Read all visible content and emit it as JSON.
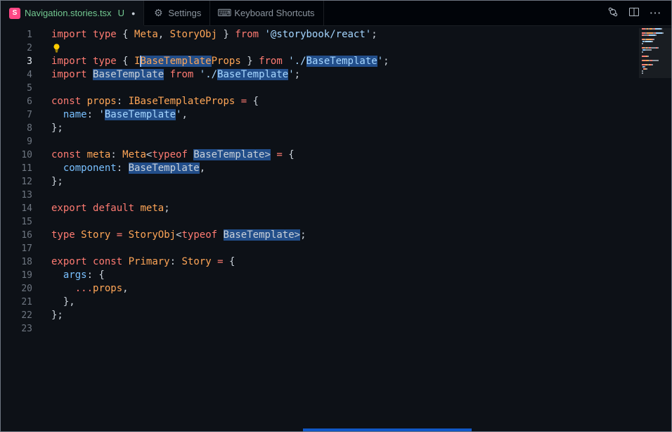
{
  "colors": {
    "editor_bg": "#0d1117",
    "tabbar_bg": "#010409",
    "accent_selection": "rgba(56,139,253,0.5)",
    "keyword": "#ff7b72",
    "type": "#ffa657",
    "property": "#79c0ff",
    "string": "#a5d6ff",
    "foreground": "#c9d1d9",
    "untracked_green": "#73c991",
    "storybook_pink": "#ff4785",
    "progress_blue": "#1158c7"
  },
  "tab_bar": {
    "modified_dot": "●",
    "tabs": [
      {
        "id": "navigation-stories",
        "label": "Navigation.stories.tsx",
        "icon": "storybook",
        "glyph": "S",
        "badge": "U",
        "modified": true,
        "active": true
      },
      {
        "id": "settings",
        "label": "Settings",
        "icon": "gear",
        "glyph": "⚙",
        "active": false
      },
      {
        "id": "keyboard-shortcuts",
        "label": "Keyboard Shortcuts",
        "icon": "keyboard",
        "glyph": "⌨",
        "active": false
      }
    ],
    "actions": [
      {
        "id": "open-changes"
      },
      {
        "id": "split-editor"
      },
      {
        "id": "more-actions",
        "glyph": "⋯"
      }
    ]
  },
  "editor": {
    "active_line": 3,
    "total_lines": 23,
    "lines": [
      {
        "n": 1,
        "t": [
          [
            "import",
            "kw"
          ],
          [
            " ",
            "fg"
          ],
          [
            "type",
            "kw"
          ],
          [
            " { ",
            "fg"
          ],
          [
            "Meta",
            "typ"
          ],
          [
            ", ",
            "fg"
          ],
          [
            "StoryObj",
            "typ"
          ],
          [
            " } ",
            "fg"
          ],
          [
            "from",
            "kw"
          ],
          [
            " ",
            "fg"
          ],
          [
            "'@storybook/react'",
            "str"
          ],
          [
            ";",
            "fg"
          ]
        ]
      },
      {
        "n": 2,
        "lightbulb": true,
        "t": []
      },
      {
        "n": 3,
        "t": [
          [
            "import",
            "kw"
          ],
          [
            " ",
            "fg"
          ],
          [
            "type",
            "kw"
          ],
          [
            " { ",
            "fg"
          ],
          [
            "I",
            "typ"
          ],
          [
            "",
            "cursor"
          ],
          [
            "BaseTemplate",
            "typ",
            1
          ],
          [
            "Props",
            "typ"
          ],
          [
            " } ",
            "fg"
          ],
          [
            "from",
            "kw"
          ],
          [
            " ",
            "fg"
          ],
          [
            "'./",
            "str"
          ],
          [
            "BaseTemplate",
            "str",
            1
          ],
          [
            "'",
            "str"
          ],
          [
            ";",
            "fg"
          ]
        ]
      },
      {
        "n": 4,
        "t": [
          [
            "import",
            "kw"
          ],
          [
            " ",
            "fg"
          ],
          [
            "BaseTemplate",
            "fg",
            1
          ],
          [
            " ",
            "fg"
          ],
          [
            "from",
            "kw"
          ],
          [
            " ",
            "fg"
          ],
          [
            "'./",
            "str"
          ],
          [
            "BaseTemplate",
            "str",
            1
          ],
          [
            "'",
            "str"
          ],
          [
            ";",
            "fg"
          ]
        ]
      },
      {
        "n": 5,
        "t": []
      },
      {
        "n": 6,
        "t": [
          [
            "const",
            "kw"
          ],
          [
            " ",
            "fg"
          ],
          [
            "props",
            "typ"
          ],
          [
            ": ",
            "fg"
          ],
          [
            "IBaseTemplateProps",
            "typ"
          ],
          [
            " ",
            "fg"
          ],
          [
            "=",
            "kw"
          ],
          [
            " {",
            "fg"
          ]
        ]
      },
      {
        "n": 7,
        "t": [
          [
            "  ",
            "fg"
          ],
          [
            "name",
            "prop"
          ],
          [
            ": ",
            "fg"
          ],
          [
            "'",
            "str"
          ],
          [
            "BaseTemplate",
            "str",
            1
          ],
          [
            "'",
            "str"
          ],
          [
            ",",
            "fg"
          ]
        ]
      },
      {
        "n": 8,
        "t": [
          [
            "};",
            "fg"
          ]
        ]
      },
      {
        "n": 9,
        "t": []
      },
      {
        "n": 10,
        "t": [
          [
            "const",
            "kw"
          ],
          [
            " ",
            "fg"
          ],
          [
            "meta",
            "typ"
          ],
          [
            ": ",
            "fg"
          ],
          [
            "Meta",
            "typ"
          ],
          [
            "<",
            "fg"
          ],
          [
            "typeof",
            "kw"
          ],
          [
            " ",
            "fg"
          ],
          [
            "BaseTemplate",
            "fg",
            1
          ],
          [
            ">",
            "fg",
            1
          ],
          [
            " ",
            "fg"
          ],
          [
            "=",
            "kw"
          ],
          [
            " {",
            "fg"
          ]
        ]
      },
      {
        "n": 11,
        "t": [
          [
            "  ",
            "fg"
          ],
          [
            "component",
            "prop"
          ],
          [
            ": ",
            "fg"
          ],
          [
            "BaseTemplate",
            "fg",
            1
          ],
          [
            ",",
            "fg"
          ]
        ]
      },
      {
        "n": 12,
        "t": [
          [
            "};",
            "fg"
          ]
        ]
      },
      {
        "n": 13,
        "t": []
      },
      {
        "n": 14,
        "t": [
          [
            "export",
            "kw"
          ],
          [
            " ",
            "fg"
          ],
          [
            "default",
            "kw"
          ],
          [
            " ",
            "fg"
          ],
          [
            "meta",
            "typ"
          ],
          [
            ";",
            "fg"
          ]
        ]
      },
      {
        "n": 15,
        "t": []
      },
      {
        "n": 16,
        "t": [
          [
            "type",
            "kw"
          ],
          [
            " ",
            "fg"
          ],
          [
            "Story",
            "typ"
          ],
          [
            " ",
            "fg"
          ],
          [
            "=",
            "kw"
          ],
          [
            " ",
            "fg"
          ],
          [
            "StoryObj",
            "typ"
          ],
          [
            "<",
            "fg"
          ],
          [
            "typeof",
            "kw"
          ],
          [
            " ",
            "fg"
          ],
          [
            "BaseTemplate",
            "fg",
            1
          ],
          [
            ">",
            "fg",
            1
          ],
          [
            ";",
            "fg"
          ]
        ]
      },
      {
        "n": 17,
        "t": []
      },
      {
        "n": 18,
        "t": [
          [
            "export",
            "kw"
          ],
          [
            " ",
            "fg"
          ],
          [
            "const",
            "kw"
          ],
          [
            " ",
            "fg"
          ],
          [
            "Primary",
            "typ"
          ],
          [
            ": ",
            "fg"
          ],
          [
            "Story",
            "typ"
          ],
          [
            " ",
            "fg"
          ],
          [
            "=",
            "kw"
          ],
          [
            " {",
            "fg"
          ]
        ]
      },
      {
        "n": 19,
        "t": [
          [
            "  ",
            "fg"
          ],
          [
            "args",
            "prop"
          ],
          [
            ": {",
            "fg"
          ]
        ]
      },
      {
        "n": 20,
        "t": [
          [
            "    ",
            "fg"
          ],
          [
            "...",
            "kw"
          ],
          [
            "props",
            "typ"
          ],
          [
            ",",
            "fg"
          ]
        ]
      },
      {
        "n": 21,
        "t": [
          [
            "  },",
            "fg"
          ]
        ]
      },
      {
        "n": 22,
        "t": [
          [
            "};",
            "fg"
          ]
        ]
      },
      {
        "n": 23,
        "t": []
      }
    ]
  }
}
